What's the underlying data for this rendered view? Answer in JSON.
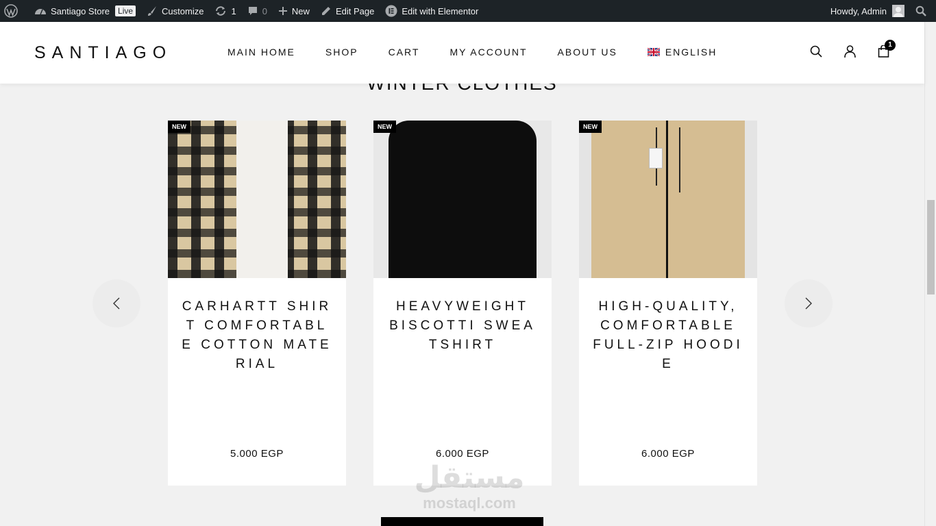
{
  "admin_bar": {
    "site_name": "Santiago Store",
    "live_badge": "Live",
    "customize": "Customize",
    "updates_count": "1",
    "comments_count": "0",
    "new": "New",
    "edit_page": "Edit Page",
    "edit_elementor": "Edit with Elementor",
    "howdy": "Howdy, Admin"
  },
  "header": {
    "logo": "SANTIAGO",
    "nav": [
      "MAIN HOME",
      "SHOP",
      "CART",
      "MY ACCOUNT",
      "ABOUT US"
    ],
    "language": "ENGLISH",
    "cart_count": "1"
  },
  "section": {
    "title": "WINTER CLOTHES"
  },
  "products": [
    {
      "badge": "NEW",
      "name": "CARHARTT SHIRT COMFORTABLE COTTON MATERIAL",
      "price": "5.000 EGP"
    },
    {
      "badge": "NEW",
      "name": "HEAVYWEIGHT BISCOTTI SWEATSHIRT",
      "price": "6.000 EGP"
    },
    {
      "badge": "NEW",
      "name": "HIGH-QUALITY, COMFORTABLE FULL-ZIP HOODIE",
      "price": "6.000 EGP"
    }
  ],
  "watermark": {
    "arabic": "مستقل",
    "latin": "mostaql.com"
  }
}
